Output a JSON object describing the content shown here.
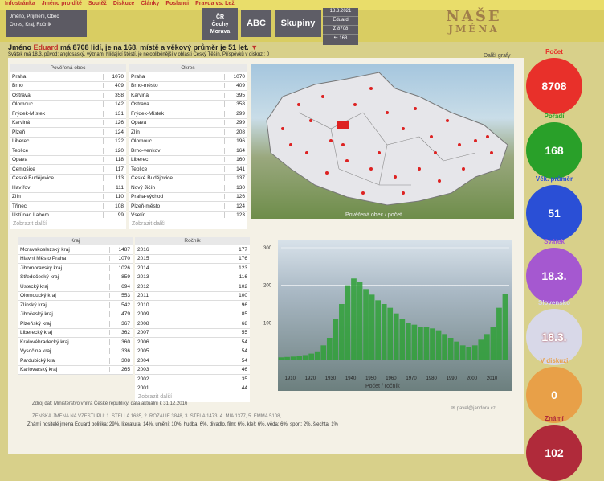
{
  "top_nav": [
    "Infostránka",
    "Jméno pro dítě",
    "Soutěž",
    "Diskuze",
    "Články",
    "Poslanci",
    "Pravda vs. Lež"
  ],
  "search": {
    "line1": "Jméno, Příjmení, Obec",
    "line2": "Okres, Kraj, Ročník"
  },
  "nav_buttons": {
    "cr_line1": "ČR",
    "cr_line2": "Čechy",
    "cr_line3": "Morava",
    "abc": "ABC",
    "groups": "Skupiny"
  },
  "info_box": {
    "date": "18.3.2021",
    "name": "Eduard",
    "sum_icon": "Σ",
    "sum_value": "8708",
    "rank_icon": "⇆",
    "rank_value": "168"
  },
  "logo": {
    "line1": "NAŠE",
    "line2": "JMÉNA"
  },
  "headline": {
    "p1": "Jméno ",
    "name": "Eduard",
    "p2": " má 8708 lidí, je na 168. místě a věkový průměr je 51 let.",
    "arrow": "▼"
  },
  "subline": "Svátek má 18.3. původ: anglosaský, význam: hlídající štěstí, je nejobliběnější v oblasti Český Těšín. Příspěvků v diskuzi: 0",
  "more_charts": "Další grafy",
  "table_obec": {
    "title": "Pověřená obec",
    "rows": [
      [
        "Praha",
        "1070"
      ],
      [
        "Brno",
        "409"
      ],
      [
        "Ostrava",
        "358"
      ],
      [
        "Olomouc",
        "142"
      ],
      [
        "Frýdek-Místek",
        "131"
      ],
      [
        "Karviná",
        "126"
      ],
      [
        "Plzeň",
        "124"
      ],
      [
        "Liberec",
        "122"
      ],
      [
        "Teplice",
        "120"
      ],
      [
        "Opava",
        "118"
      ],
      [
        "Čemošice",
        "117"
      ],
      [
        "České Budějovice",
        "113"
      ],
      [
        "Havířov",
        "111"
      ],
      [
        "Zlín",
        "110"
      ],
      [
        "Třinec",
        "108"
      ],
      [
        "Ústí nad Labem",
        "99"
      ]
    ],
    "more": "Zobrazit další"
  },
  "table_okres": {
    "title": "Okres",
    "rows": [
      [
        "Praha",
        "1070"
      ],
      [
        "Brno-město",
        "409"
      ],
      [
        "Karviná",
        "395"
      ],
      [
        "Ostrava",
        "358"
      ],
      [
        "Frýdek-Místek",
        "299"
      ],
      [
        "Opava",
        "299"
      ],
      [
        "Zlín",
        "208"
      ],
      [
        "Olomouc",
        "196"
      ],
      [
        "Brno-venkov",
        "164"
      ],
      [
        "Liberec",
        "160"
      ],
      [
        "Teplice",
        "141"
      ],
      [
        "České Budějovice",
        "137"
      ],
      [
        "Nový Jičín",
        "130"
      ],
      [
        "Praha-východ",
        "126"
      ],
      [
        "Plzeň-město",
        "124"
      ],
      [
        "Vsetín",
        "123"
      ]
    ],
    "more": "Zobrazit další"
  },
  "table_kraj": {
    "title": "Kraj",
    "rows": [
      [
        "Moravskoslezský kraj",
        "1487"
      ],
      [
        "Hlavní Město Praha",
        "1070"
      ],
      [
        "Jihomoravský kraj",
        "1026"
      ],
      [
        "Středočeský kraj",
        "859"
      ],
      [
        "Ústecký kraj",
        "694"
      ],
      [
        "Olomoucký kraj",
        "553"
      ],
      [
        "Zlínský kraj",
        "542"
      ],
      [
        "Jihočeský kraj",
        "479"
      ],
      [
        "Plzeňský kraj",
        "367"
      ],
      [
        "Liberecký kraj",
        "362"
      ],
      [
        "Královéhradecký kraj",
        "360"
      ],
      [
        "Vysočina kraj",
        "336"
      ],
      [
        "Pardubický kraj",
        "308"
      ],
      [
        "Karlovarský kraj",
        "265"
      ]
    ]
  },
  "table_rocnik": {
    "title": "Ročník",
    "rows": [
      [
        "2016",
        "177"
      ],
      [
        "2015",
        "176"
      ],
      [
        "2014",
        "123"
      ],
      [
        "2013",
        "116"
      ],
      [
        "2012",
        "102"
      ],
      [
        "2011",
        "100"
      ],
      [
        "2010",
        "96"
      ],
      [
        "2009",
        "85"
      ],
      [
        "2008",
        "68"
      ],
      [
        "2007",
        "55"
      ],
      [
        "2006",
        "54"
      ],
      [
        "2005",
        "54"
      ],
      [
        "2004",
        "54"
      ],
      [
        "2003",
        "46"
      ],
      [
        "2002",
        "35"
      ],
      [
        "2001",
        "44"
      ]
    ],
    "more": "Zobrazit další"
  },
  "map_caption": "Pověřená obec / počet",
  "chart_data": {
    "type": "bar",
    "title": "",
    "xlabel": "Počet / ročník",
    "ylabel": "",
    "x_ticks": [
      "1910",
      "1920",
      "1930",
      "1940",
      "1950",
      "1960",
      "1970",
      "1980",
      "1990",
      "2000",
      "2010"
    ],
    "y_ticks": [
      "100",
      "200",
      "300"
    ],
    "xlim": [
      1905,
      2018
    ],
    "ylim": [
      0,
      300
    ],
    "x": [
      1905,
      1908,
      1911,
      1914,
      1917,
      1920,
      1923,
      1926,
      1929,
      1932,
      1935,
      1938,
      1941,
      1944,
      1947,
      1950,
      1953,
      1956,
      1959,
      1962,
      1965,
      1968,
      1971,
      1974,
      1977,
      1980,
      1983,
      1986,
      1989,
      1992,
      1995,
      1998,
      2001,
      2004,
      2007,
      2010,
      2013,
      2016
    ],
    "values": [
      8,
      9,
      10,
      12,
      14,
      18,
      24,
      40,
      60,
      110,
      150,
      200,
      218,
      210,
      190,
      175,
      160,
      150,
      140,
      125,
      110,
      100,
      95,
      90,
      88,
      85,
      80,
      70,
      60,
      50,
      40,
      35,
      40,
      55,
      70,
      90,
      140,
      177
    ],
    "color": "#2ea036"
  },
  "sidebar": [
    {
      "label": "Počet",
      "value": "8708",
      "color": "#e8302a"
    },
    {
      "label": "Pořadí",
      "value": "168",
      "color": "#29a029"
    },
    {
      "label": "Věk. průměr",
      "value": "51",
      "color": "#2a4fd6"
    },
    {
      "label": "Svátek",
      "value": "18.3.",
      "color": "#a558d0"
    },
    {
      "label": "Slovensko",
      "value": "18.3.",
      "color": "#d8d8e8"
    },
    {
      "label": "V diskuzi",
      "value": "0",
      "color": "#e8a048"
    },
    {
      "label": "Známí",
      "value": "102",
      "color": "#b02a3a"
    }
  ],
  "source_note": "Zdroj dat: Ministerstvo vnitra České republiky, data aktuální k 31.12.2016",
  "email": "pavel@jandora.cz",
  "female_names": "ŽENSKÁ JMÉNA NA VZESTUPU: 1. STELLA 1685, 2. ROZALIE 3848, 3. STELA 1473, 4. MIA 1377, 5. EMMA 5108,",
  "known_holders": "Známí nositelé jména Eduard politika: 29%, literatura: 14%, umění: 10%, hudba: 6%, divadlo, film: 6%, kleř: 6%, věda: 6%, sport: 2%, šlechta: 1%"
}
